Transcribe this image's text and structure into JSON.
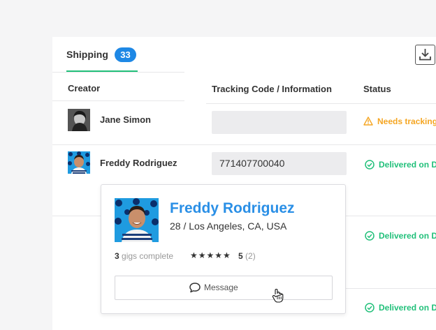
{
  "tabs": {
    "shipping_label": "Shipping",
    "shipping_count": "33",
    "download_icon": "download-icon"
  },
  "table": {
    "columns": [
      "Creator",
      "Tracking Code / Information",
      "Status"
    ],
    "rows": [
      {
        "name": "Jane Simon",
        "tracking": "",
        "status": "Needs tracking",
        "status_type": "warning"
      },
      {
        "name": "Freddy Rodriguez",
        "tracking": "771407700040",
        "status": "Delivered on D",
        "status_type": "delivered"
      },
      {
        "name": "",
        "tracking": "",
        "status": "Delivered on D",
        "status_type": "delivered"
      },
      {
        "name": "",
        "tracking": "",
        "status": "Delivered on D",
        "status_type": "delivered"
      }
    ]
  },
  "popover": {
    "name": "Freddy Rodriguez",
    "location": "28 / Los Angeles, CA, USA",
    "gigs_count": "3",
    "gigs_label": "gigs complete",
    "stars": "★★★★★",
    "rating": "5",
    "rating_count": "(2)",
    "message_label": "Message"
  },
  "colors": {
    "accent_blue": "#1e88e5",
    "green": "#21c07a",
    "orange": "#f5a623"
  }
}
